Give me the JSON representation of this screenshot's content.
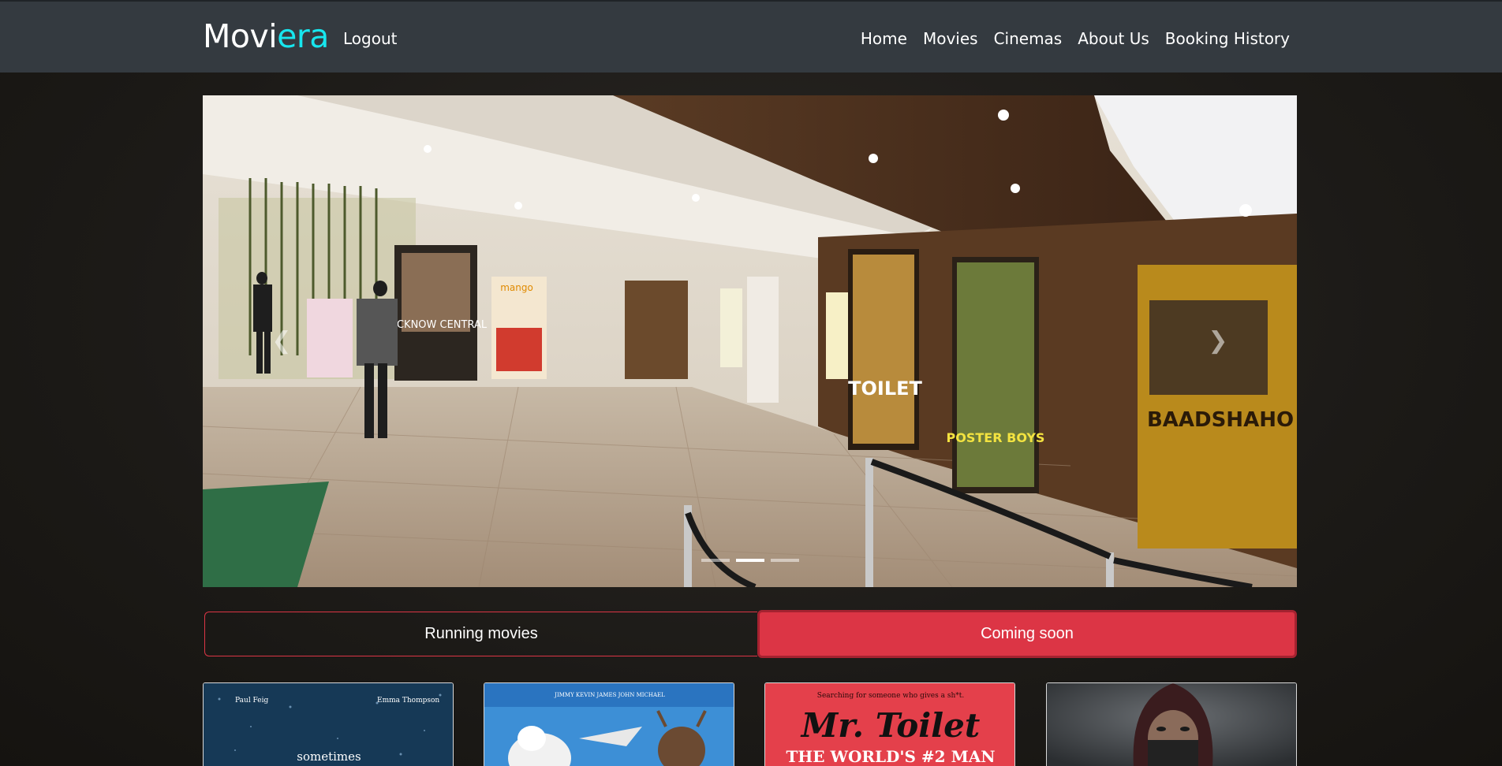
{
  "navbar": {
    "brand_part1": "Movi",
    "brand_part2": "era",
    "logout_label": "Logout",
    "links": [
      "Home",
      "Movies",
      "Cinemas",
      "About Us",
      "Booking History"
    ]
  },
  "carousel": {
    "prev_icon": "chevron-left-icon",
    "next_icon": "chevron-right-icon",
    "slide_count": 3,
    "active_slide": 2,
    "poster_texts": [
      "LUCKNOW CENTRAL",
      "mango",
      "TOILET",
      "POSTER BOYS",
      "BAADSHAHO"
    ]
  },
  "tabs": {
    "running_label": "Running movies",
    "coming_label": "Coming soon",
    "active": "coming"
  },
  "movies": [
    {
      "credits_line1": "Paul Feig",
      "credits_line2": "Emma Thompson",
      "title_text": "sometimes"
    },
    {
      "credits_line1": "JIMMY  KEVIN  JAMES  JOHN  MICHAEL",
      "title_text": ""
    },
    {
      "tagline": "Searching for someone who gives a sh*t.",
      "title_text": "Mr. Toilet",
      "subtitle": "THE WORLD'S #2 MAN"
    },
    {
      "title_text": ""
    }
  ],
  "colors": {
    "navbar_bg": "#343a40",
    "brand_accent": "#17e6ee",
    "tab_active": "#dc3545",
    "page_bg": "#1c1a17"
  }
}
